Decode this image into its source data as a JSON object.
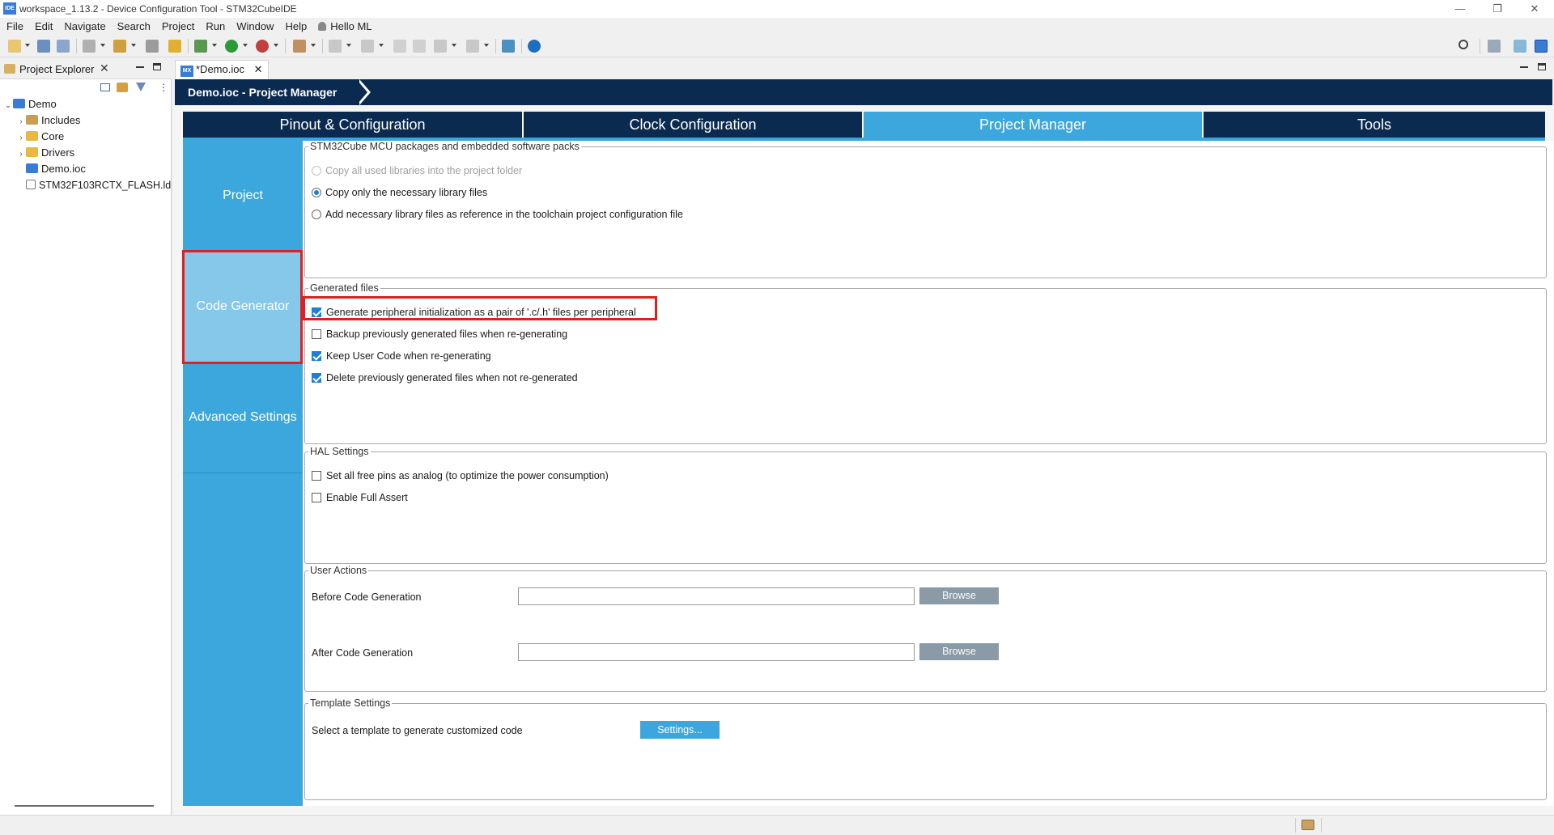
{
  "window": {
    "title": "workspace_1.13.2 - Device Configuration Tool - STM32CubeIDE",
    "app_icon_text": "IDE",
    "minimize": "—",
    "restore": "❐",
    "close": "✕"
  },
  "menu": [
    "File",
    "Edit",
    "Navigate",
    "Search",
    "Project",
    "Run",
    "Window",
    "Help"
  ],
  "user": {
    "icon": "person-icon",
    "label": "Hello ML"
  },
  "explorer": {
    "title": "Project Explorer",
    "tree": [
      {
        "label": "Demo",
        "icon": "project-icon",
        "expanded": true
      },
      {
        "label": "Includes",
        "icon": "includes-icon"
      },
      {
        "label": "Core",
        "icon": "folder-icon"
      },
      {
        "label": "Drivers",
        "icon": "folder-icon"
      },
      {
        "label": "Demo.ioc",
        "icon": "ioc-file-icon"
      },
      {
        "label": "STM32F103RCTX_FLASH.ld",
        "icon": "ld-file-icon"
      }
    ]
  },
  "editor": {
    "tab_label": "*Demo.ioc",
    "tab_badge": "MX",
    "breadcrumb": "Demo.ioc - Project Manager",
    "main_tabs": [
      {
        "label": "Pinout & Configuration",
        "active": false
      },
      {
        "label": "Clock Configuration",
        "active": false
      },
      {
        "label": "Project Manager",
        "active": true
      },
      {
        "label": "Tools",
        "active": false
      }
    ],
    "nav": [
      {
        "label": "Project",
        "active": false
      },
      {
        "label": "Code Generator",
        "active": true
      },
      {
        "label": "Advanced Settings",
        "active": false
      }
    ]
  },
  "packs": {
    "legend": "STM32Cube MCU packages and embedded software packs",
    "options": [
      {
        "label": "Copy all used libraries into the project folder",
        "checked": false,
        "disabled": true
      },
      {
        "label": "Copy only the necessary library files",
        "checked": true,
        "disabled": false
      },
      {
        "label": "Add necessary library files as reference in the toolchain project configuration file",
        "checked": false,
        "disabled": false
      }
    ]
  },
  "generated": {
    "legend": "Generated files",
    "options": [
      {
        "label": "Generate peripheral initialization as a pair of '.c/.h' files per peripheral",
        "checked": true
      },
      {
        "label": "Backup previously generated files when re-generating",
        "checked": false
      },
      {
        "label": "Keep User Code when re-generating",
        "checked": true
      },
      {
        "label": "Delete previously generated files when not re-generated",
        "checked": true
      }
    ]
  },
  "hal": {
    "legend": "HAL Settings",
    "options": [
      {
        "label": "Set all free pins as analog (to optimize the power consumption)",
        "checked": false
      },
      {
        "label": "Enable Full Assert",
        "checked": false
      }
    ]
  },
  "user_actions": {
    "legend": "User Actions",
    "before_label": "Before Code Generation",
    "before_value": "",
    "after_label": "After Code Generation",
    "after_value": "",
    "browse_label": "Browse"
  },
  "template": {
    "legend": "Template Settings",
    "label": "Select a template to generate customized code",
    "button": "Settings..."
  },
  "colors": {
    "dark_navy": "#0b2a50",
    "accent_blue": "#3ba7dc",
    "highlight_red": "#e02020"
  }
}
